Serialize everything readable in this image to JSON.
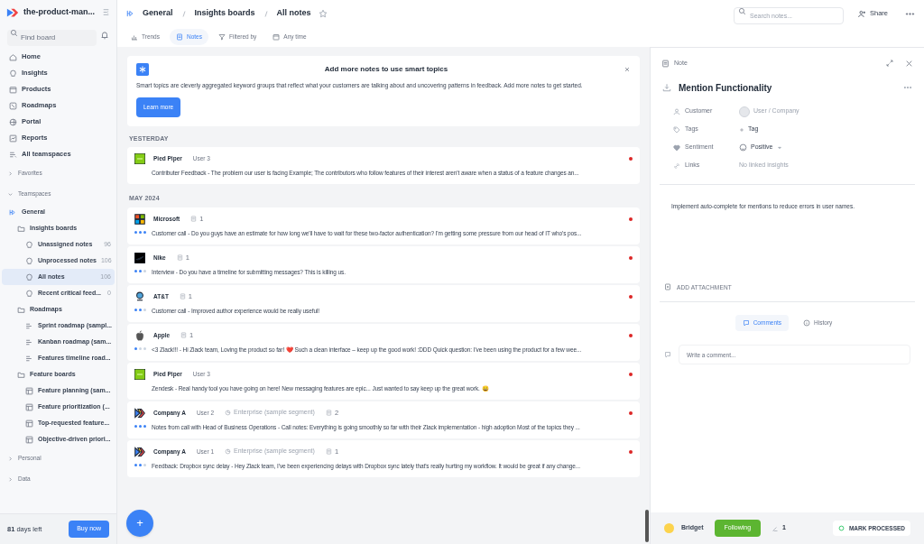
{
  "sidebar": {
    "workspace": "the-product-man...",
    "search": {
      "placeholder": "Find board"
    },
    "nav": [
      {
        "label": "Home",
        "selected": false
      },
      {
        "label": "Insights",
        "selected": false
      },
      {
        "label": "Products",
        "selected": false
      },
      {
        "label": "Roadmaps",
        "selected": false
      },
      {
        "label": "Portal",
        "selected": false
      },
      {
        "label": "Reports",
        "selected": false
      },
      {
        "label": "All teamspaces",
        "selected": false
      }
    ],
    "sections": [
      {
        "label": "Favorites",
        "expanded": false
      },
      {
        "label": "Teamspaces",
        "expanded": true,
        "tree": [
          {
            "label": "General",
            "kind": "space",
            "selected": false,
            "children": [
              {
                "label": "Insights boards",
                "kind": "folder",
                "selected": false,
                "children": [
                  {
                    "label": "Unassigned notes",
                    "kind": "notes",
                    "count": "96",
                    "selected": false
                  },
                  {
                    "label": "Unprocessed notes",
                    "kind": "notes",
                    "count": "106",
                    "selected": false
                  },
                  {
                    "label": "All notes",
                    "kind": "notes",
                    "count": "106",
                    "selected": true
                  },
                  {
                    "label": "Recent critical feed...",
                    "kind": "notes",
                    "count": "0",
                    "selected": false
                  }
                ]
              },
              {
                "label": "Roadmaps",
                "kind": "folder",
                "selected": false,
                "children": [
                  {
                    "label": "Sprint roadmap (sampl...",
                    "kind": "roadmap",
                    "selected": false
                  },
                  {
                    "label": "Kanban roadmap (sam...",
                    "kind": "roadmap",
                    "selected": false
                  },
                  {
                    "label": "Features timeline road...",
                    "kind": "roadmap",
                    "selected": false
                  }
                ]
              },
              {
                "label": "Feature boards",
                "kind": "folder",
                "selected": false,
                "children": [
                  {
                    "label": "Feature planning (sam...",
                    "kind": "board",
                    "selected": false
                  },
                  {
                    "label": "Feature prioritization (...",
                    "kind": "board",
                    "selected": false
                  },
                  {
                    "label": "Top-requested feature...",
                    "kind": "board",
                    "selected": false
                  },
                  {
                    "label": "Objective-driven priori...",
                    "kind": "board",
                    "selected": false
                  }
                ]
              }
            ]
          }
        ]
      },
      {
        "label": "Personal",
        "expanded": false
      },
      {
        "label": "Data",
        "expanded": false
      }
    ],
    "trial": "**81** days left",
    "buy_button": "Buy now"
  },
  "breadcrumb": [
    "General",
    "Insights boards",
    "All notes"
  ],
  "search": {
    "placeholder": "Search notes..."
  },
  "share_button": "Share",
  "view_tabs": [
    {
      "label": "Trends",
      "selected": false
    },
    {
      "label": "Notes",
      "selected": true
    },
    {
      "label": "Filtered by",
      "selected": false
    },
    {
      "label": "Any time",
      "selected": false
    }
  ],
  "banner": {
    "title": "Add more notes to use smart topics",
    "text": "Smart topics are cleverly aggregated keyword groups that reflect what your customers are talking about and uncovering patterns in feedback. Add more notes to get started.",
    "button": "Learn more"
  },
  "groups": [
    {
      "label": "YESTERDAY",
      "notes": [
        {
          "kind": "piedpiper",
          "company": "Pied Piper",
          "user": "User 3",
          "text": "Contributer Feedback - The problem our user is facing Example; The contributors who follow features of their interest aren't aware when a status of a feature changes an...",
          "unread": true
        }
      ]
    },
    {
      "label": "MAY 2024",
      "notes": [
        {
          "kind": "microsoft",
          "company": "Microsoft",
          "links": "1",
          "stars": 3,
          "text": "Customer call - Do you guys have an estimate for how long we'll have to wait for these two-factor authentication? I'm getting some pressure from our head of IT who's pos...",
          "unread": true
        },
        {
          "kind": "nike",
          "company": "Nike",
          "links": "1",
          "stars": 2,
          "text": "Interview - Do you have a timeline for submitting messages? This is killing us.",
          "unread": true
        },
        {
          "kind": "att",
          "company": "AT&T",
          "links": "1",
          "stars": 2,
          "text": "Customer call - Improved author experience would be really useful!",
          "unread": true
        },
        {
          "kind": "apple",
          "company": "Apple",
          "links": "1",
          "stars": 1,
          "text": "<3 Zlack!!! - Hi Zlack team, Loving the product so far! ❤️ Such a clean interface – keep up the good work! :DDD Quick question: I've been using the product for a few wee...",
          "unread": true
        },
        {
          "kind": "piedpiper",
          "company": "Pied Piper",
          "user": "User 3",
          "text": "Zendesk - Real handy tool you have going on here! New messaging features are epic... Just wanted to say keep up the great work. 😄",
          "unread": true
        },
        {
          "kind": "companya",
          "company": "Company A",
          "user": "User 2",
          "segment": "Enterprise (sample segment)",
          "links": "2",
          "stars": 3,
          "text": "Notes from call with Head of Business Operations - Call notes: Everything is going smoothly so far with their Zlack implementation - high adoption Most of the topics they ...",
          "unread": true
        },
        {
          "kind": "companya",
          "company": "Company A",
          "user": "User 1",
          "segment": "Enterprise (sample segment)",
          "links": "1",
          "stars": 2,
          "text": "Feedback: Dropbox sync delay - Hey Zlack team, I've been experiencing delays with Dropbox sync lately that's really hurting my workflow. It would be great if any change...",
          "unread": true
        }
      ]
    }
  ],
  "add_button": "+",
  "note": {
    "header": "Note",
    "title": "Mention Functionality",
    "fields": [
      {
        "label": "Customer",
        "kind": "customer",
        "placeholder": "User / Company"
      },
      {
        "label": "Tags",
        "kind": "tag",
        "value": "Tag"
      },
      {
        "label": "Sentiment",
        "kind": "sentiment",
        "value": "Positive"
      },
      {
        "label": "Links",
        "kind": "links",
        "value": "No linked insights"
      }
    ],
    "body": "Implement auto-complete for mentions to reduce errors in user names.",
    "attachment": "ADD ATTACHMENT",
    "tabs": [
      {
        "label": "Comments",
        "selected": true
      },
      {
        "label": "History",
        "selected": false
      }
    ],
    "comment": {
      "placeholder": "Write a comment..."
    },
    "owner": "Bridget",
    "follow_button": "Following",
    "followers": "1",
    "process_button": "MARK PROCESSED"
  }
}
